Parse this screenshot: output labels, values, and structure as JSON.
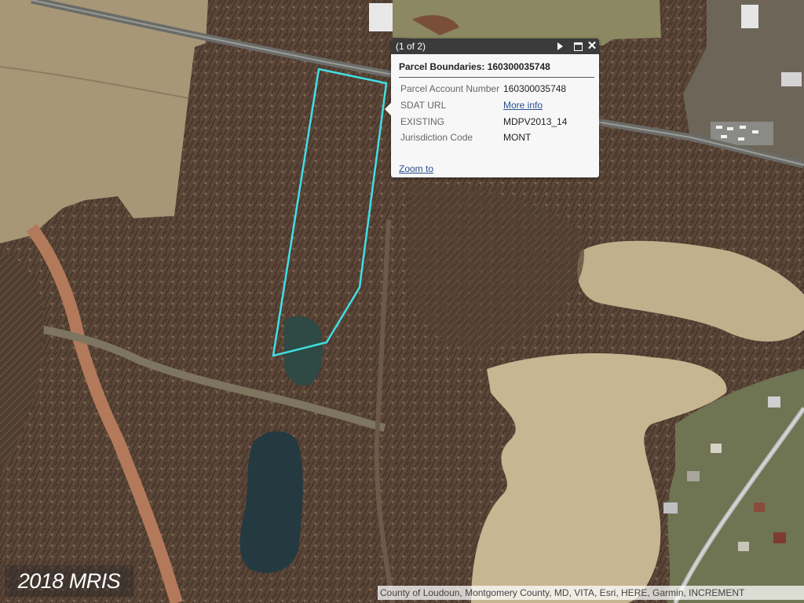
{
  "popup": {
    "counter": "(1 of 2)",
    "title": "Parcel Boundaries: 160300035748",
    "attributes": [
      {
        "label": "Parcel Account Number",
        "value": "160300035748",
        "link": false
      },
      {
        "label": "SDAT URL",
        "value": "More info",
        "link": true
      },
      {
        "label": "EXISTING",
        "value": "MDPV2013_14",
        "link": false
      },
      {
        "label": "Jurisdiction Code",
        "value": "MONT",
        "link": false
      }
    ],
    "zoom_label": "Zoom to",
    "icons": {
      "next": "play-next-icon",
      "maximize": "maximize-icon",
      "close": "close-icon"
    },
    "close_glyph": "✕"
  },
  "watermark": "2018 MRIS",
  "attribution": "County of Loudoun, Montgomery County, MD, VITA, Esri, HERE, Garmin, INCREMENT",
  "colors": {
    "parcel_outline": "#3fe0e6",
    "popup_header": "#3b3b3b",
    "link": "#2a4f8f"
  }
}
